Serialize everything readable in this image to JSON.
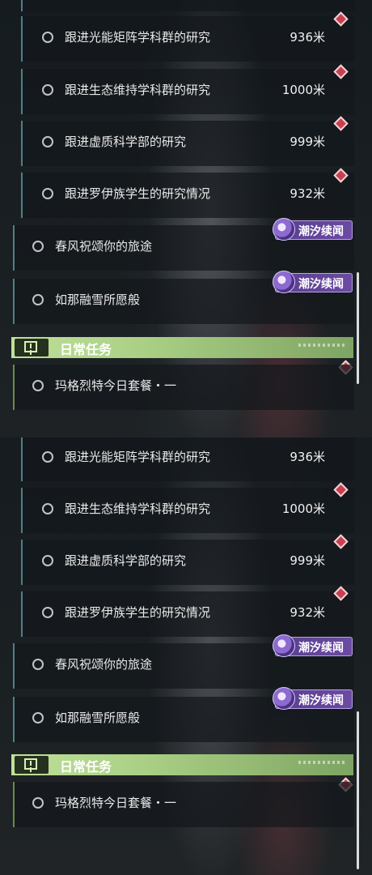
{
  "panes": [
    {
      "quests": [
        {
          "label": "跟进光能矩阵学科群的研究",
          "distance": "936米"
        },
        {
          "label": "跟进生态维持学科群的研究",
          "distance": "1000米"
        },
        {
          "label": "跟进虚质科学部的研究",
          "distance": "999米"
        },
        {
          "label": "跟进罗伊族学生的研究情况",
          "distance": "932米"
        }
      ],
      "main_quests": [
        {
          "label": "春风祝颂你的旅途",
          "tag": "潮汐续闻"
        },
        {
          "label": "如那融雪所愿般",
          "tag": "潮汐续闻"
        }
      ],
      "section": {
        "title": "日常任务",
        "icon": "exclamation-icon"
      },
      "daily": [
        {
          "label": "玛格烈特今日套餐・一"
        }
      ]
    },
    {
      "quests": [
        {
          "label": "跟进光能矩阵学科群的研究",
          "distance": "936米"
        },
        {
          "label": "跟进生态维持学科群的研究",
          "distance": "1000米"
        },
        {
          "label": "跟进虚质科学部的研究",
          "distance": "999米"
        },
        {
          "label": "跟进罗伊族学生的研究情况",
          "distance": "932米"
        }
      ],
      "main_quests": [
        {
          "label": "春风祝颂你的旅途",
          "tag": "潮汐续闻"
        },
        {
          "label": "如那融雪所愿般",
          "tag": "潮汐续闻"
        }
      ],
      "section": {
        "title": "日常任务",
        "icon": "exclamation-icon"
      },
      "daily": [
        {
          "label": "玛格烈特今日套餐・一"
        }
      ]
    }
  ],
  "colors": {
    "accent_green": "#a9cf84",
    "tag_purple": "#6b4aa3",
    "marker_red": "#c8404f",
    "row_border": "#4f7f86"
  }
}
